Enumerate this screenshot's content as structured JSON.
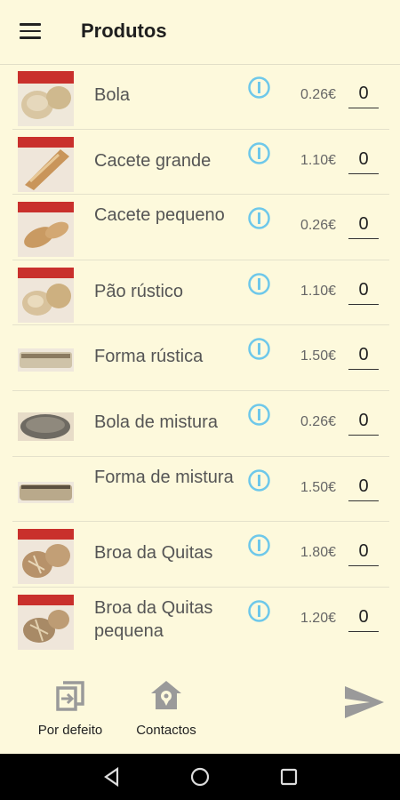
{
  "appbar": {
    "title": "Produtos",
    "menu_icon": "hamburger-menu-icon"
  },
  "products": [
    {
      "name": "Bola",
      "price": "0.26€",
      "quantity": "0",
      "thumb": "bread-roll"
    },
    {
      "name": "Cacete grande",
      "price": "1.10€",
      "quantity": "0",
      "thumb": "long-baguette"
    },
    {
      "name": "Cacete pequeno",
      "price": "0.26€",
      "quantity": "0",
      "thumb": "short-baguette"
    },
    {
      "name": "Pão rústico",
      "price": "1.10€",
      "quantity": "0",
      "thumb": "rustic-bread"
    },
    {
      "name": "Forma rústica",
      "price": "1.50€",
      "quantity": "0",
      "thumb": "sliced-loaf"
    },
    {
      "name": "Bola de mistura",
      "price": "0.26€",
      "quantity": "0",
      "thumb": "dark-round-loaf"
    },
    {
      "name": "Forma de mistura",
      "price": "1.50€",
      "quantity": "0",
      "thumb": "mixed-loaf"
    },
    {
      "name": "Broa da Quitas",
      "price": "1.80€",
      "quantity": "0",
      "thumb": "corn-bread"
    },
    {
      "name": "Broa da Quitas pequena",
      "price": "1.20€",
      "quantity": "0",
      "thumb": "small-corn-bread"
    }
  ],
  "bottom_bar": {
    "default_label": "Por defeito",
    "contacts_label": "Contactos",
    "default_icon": "swap-box-icon",
    "contacts_icon": "home-location-icon",
    "send_icon": "send-icon"
  },
  "colors": {
    "background": "#fdf9dc",
    "info_icon": "#6ec8ea",
    "icon_gray": "#9a9a9a",
    "navbar": "#000000"
  }
}
